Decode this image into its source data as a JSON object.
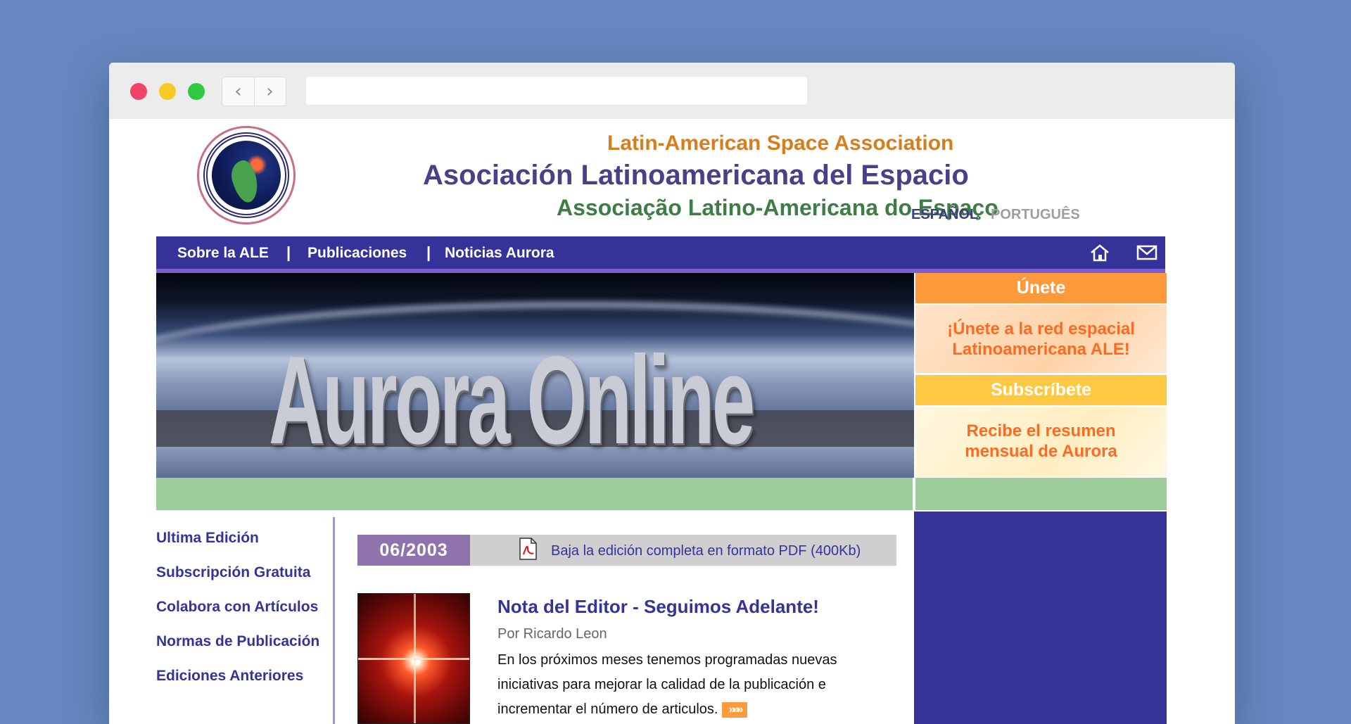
{
  "site": {
    "title_en": "Latin-American Space Association",
    "title_es": "Asociación Latinoamericana del Espacio",
    "title_pt": "Associação Latino-Americana do Espaço",
    "lang_es": "ESPAÑOL",
    "lang_pt": "PORTUGUÊS"
  },
  "nav": {
    "items": [
      "Sobre la ALE",
      "Publicaciones",
      "Noticias Aurora"
    ],
    "separator": "|"
  },
  "banner": {
    "text": "Aurora Online"
  },
  "join": {
    "heading": "Únete",
    "body_line1": "¡Únete a la red espacial",
    "body_line2": "Latinoamericana ALE!"
  },
  "subscribe": {
    "heading": "Subscríbete",
    "body_line1": "Recibe el resumen",
    "body_line2": "mensual de Aurora"
  },
  "sidebar": {
    "links": [
      "Ultima Edición",
      "Subscripción Gratuita",
      "Colabora con Artículos",
      "Normas de Publicación",
      "Ediciones Anteriores"
    ]
  },
  "edition": {
    "date": "06/2003",
    "pdf_link": "Baja la edición completa en formato PDF (400Kb)"
  },
  "article": {
    "title": "Nota del Editor - Seguimos Adelante!",
    "author": "Por Ricardo Leon",
    "body": "En los próximos meses tenemos programadas nuevas iniciativas para mejorar la calidad de la publicación e incrementar el número de articulos.",
    "more_icon": "»»»"
  },
  "colors": {
    "navbar": "#353399",
    "join": "#ff9a3c",
    "subscribe": "#ffc843",
    "green_bar": "#9dcc9b",
    "date_label": "#8f73ad"
  }
}
